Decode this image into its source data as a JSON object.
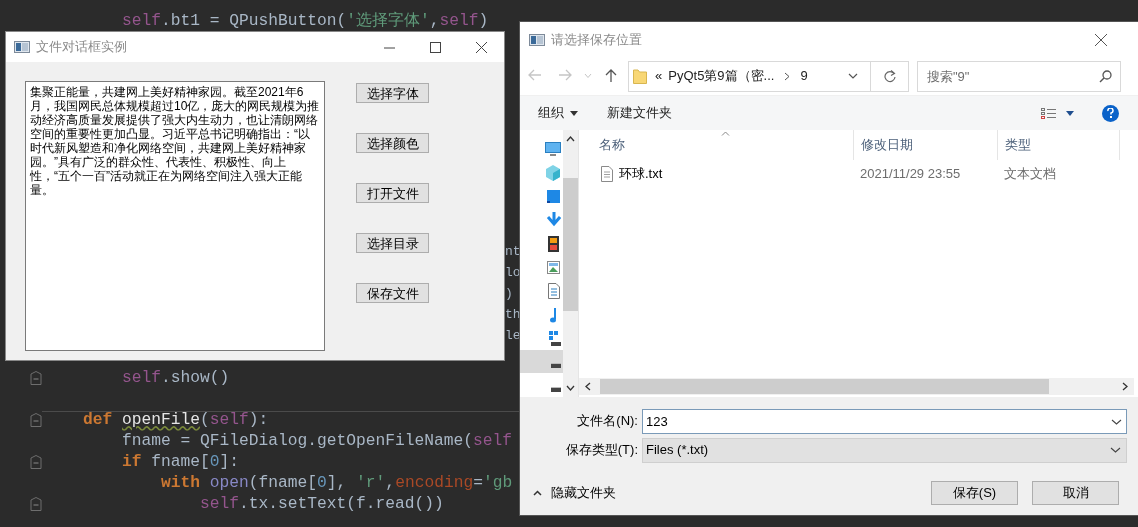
{
  "editor": {
    "lines": [
      {
        "fold": false,
        "tokens": [
          {
            "text": "        self",
            "kind": "self"
          },
          {
            "text": ".bt1 = QPushButton(",
            "kind": "plain"
          },
          {
            "text": "'选择字体'",
            "kind": "string"
          },
          {
            "text": ",",
            "kind": "plain"
          },
          {
            "text": "self",
            "kind": "self"
          },
          {
            "text": ")",
            "kind": "plain"
          }
        ]
      },
      {
        "fold": false,
        "tokens": [
          {
            "text": "nt",
            "kind": "fragment"
          }
        ]
      },
      {
        "fold": false,
        "tokens": [
          {
            "text": "lo",
            "kind": "fragment"
          }
        ]
      },
      {
        "fold": false,
        "tokens": [
          {
            "text": ")",
            "kind": "fragment"
          }
        ]
      },
      {
        "fold": false,
        "tokens": [
          {
            "text": "th",
            "kind": "fragment"
          }
        ]
      },
      {
        "fold": false,
        "tokens": [
          {
            "text": "le",
            "kind": "fragment"
          }
        ]
      },
      {
        "fold": true,
        "tokens": [
          {
            "text": "        self",
            "kind": "self"
          },
          {
            "text": ".show()",
            "kind": "plain"
          }
        ]
      },
      {
        "fold": true,
        "tokens": [
          {
            "text": "    def ",
            "kind": "keyword"
          },
          {
            "text": "openFile",
            "kind": "defname"
          },
          {
            "text": "(",
            "kind": "plain"
          },
          {
            "text": "self",
            "kind": "self"
          },
          {
            "text": "):",
            "kind": "plain"
          }
        ]
      },
      {
        "fold": false,
        "tokens": [
          {
            "text": "        fname = QFileDialog.getOpenFileName(",
            "kind": "plain"
          },
          {
            "text": "self",
            "kind": "self"
          }
        ]
      },
      {
        "fold": true,
        "tokens": [
          {
            "text": "        if",
            "kind": "keyword"
          },
          {
            "text": " fname[",
            "kind": "plain"
          },
          {
            "text": "0",
            "kind": "number"
          },
          {
            "text": "]:",
            "kind": "plain"
          }
        ]
      },
      {
        "fold": false,
        "tokens": [
          {
            "text": "            with ",
            "kind": "keyword"
          },
          {
            "text": "open",
            "kind": "builtin"
          },
          {
            "text": "(fname[",
            "kind": "plain"
          },
          {
            "text": "0",
            "kind": "number"
          },
          {
            "text": "], ",
            "kind": "plain"
          },
          {
            "text": "'r'",
            "kind": "string"
          },
          {
            "text": ",",
            "kind": "plain"
          },
          {
            "text": "encoding",
            "kind": "param"
          },
          {
            "text": "=",
            "kind": "plain"
          },
          {
            "text": "'gb",
            "kind": "string"
          }
        ]
      },
      {
        "fold": true,
        "tokens": [
          {
            "text": "                self",
            "kind": "self"
          },
          {
            "text": ".tx.setText(f.read())",
            "kind": "plain"
          }
        ]
      }
    ]
  },
  "main_window": {
    "title": "文件对话框实例",
    "text": "集聚正能量，共建网上美好精神家园。截至2021年6月，我国网民总体规模超过10亿，庞大的网民规模为推动经济高质量发展提供了强大内生动力，也让清朗网络空间的重要性更加凸显。习近平总书记明确指出：“以时代新风塑造和净化网络空间，共建网上美好精神家园。”具有广泛的群众性、代表性、积极性、向上性，“五个一百”活动就正在为网络空间注入强大正能量。",
    "buttons": [
      "选择字体",
      "选择颜色",
      "打开文件",
      "选择目录",
      "保存文件"
    ]
  },
  "save_dialog": {
    "title": "请选择保存位置",
    "address": {
      "overflow": "«",
      "crumbs": [
        "PyQt5第9篇（密...",
        "9"
      ]
    },
    "search": {
      "placeholder": "搜索\"9\""
    },
    "toolbar": {
      "organize": "组织",
      "new_folder": "新建文件夹"
    },
    "nav_items": [
      {
        "kind": "desktop",
        "selected": false
      },
      {
        "kind": "cube",
        "selected": false
      },
      {
        "kind": "square",
        "selected": false
      },
      {
        "kind": "download",
        "selected": false
      },
      {
        "kind": "film",
        "selected": false
      },
      {
        "kind": "image",
        "selected": false
      },
      {
        "kind": "document",
        "selected": false
      },
      {
        "kind": "music",
        "selected": false
      },
      {
        "kind": "tiles",
        "selected": false
      },
      {
        "kind": "drive",
        "selected": true
      },
      {
        "kind": "drive",
        "selected": false
      }
    ],
    "columns": [
      "名称",
      "修改日期",
      "类型"
    ],
    "files": [
      {
        "name": "环球.txt",
        "modified": "2021/11/29 23:55",
        "type": "文本文档",
        "selected": false
      }
    ],
    "filename": {
      "label": "文件名(N):",
      "value": "123"
    },
    "filetype": {
      "label": "保存类型(T):",
      "value": "Files (*.txt)"
    },
    "hide_folders": "隐藏文件夹",
    "buttons": [
      "保存(S)",
      "取消"
    ]
  }
}
